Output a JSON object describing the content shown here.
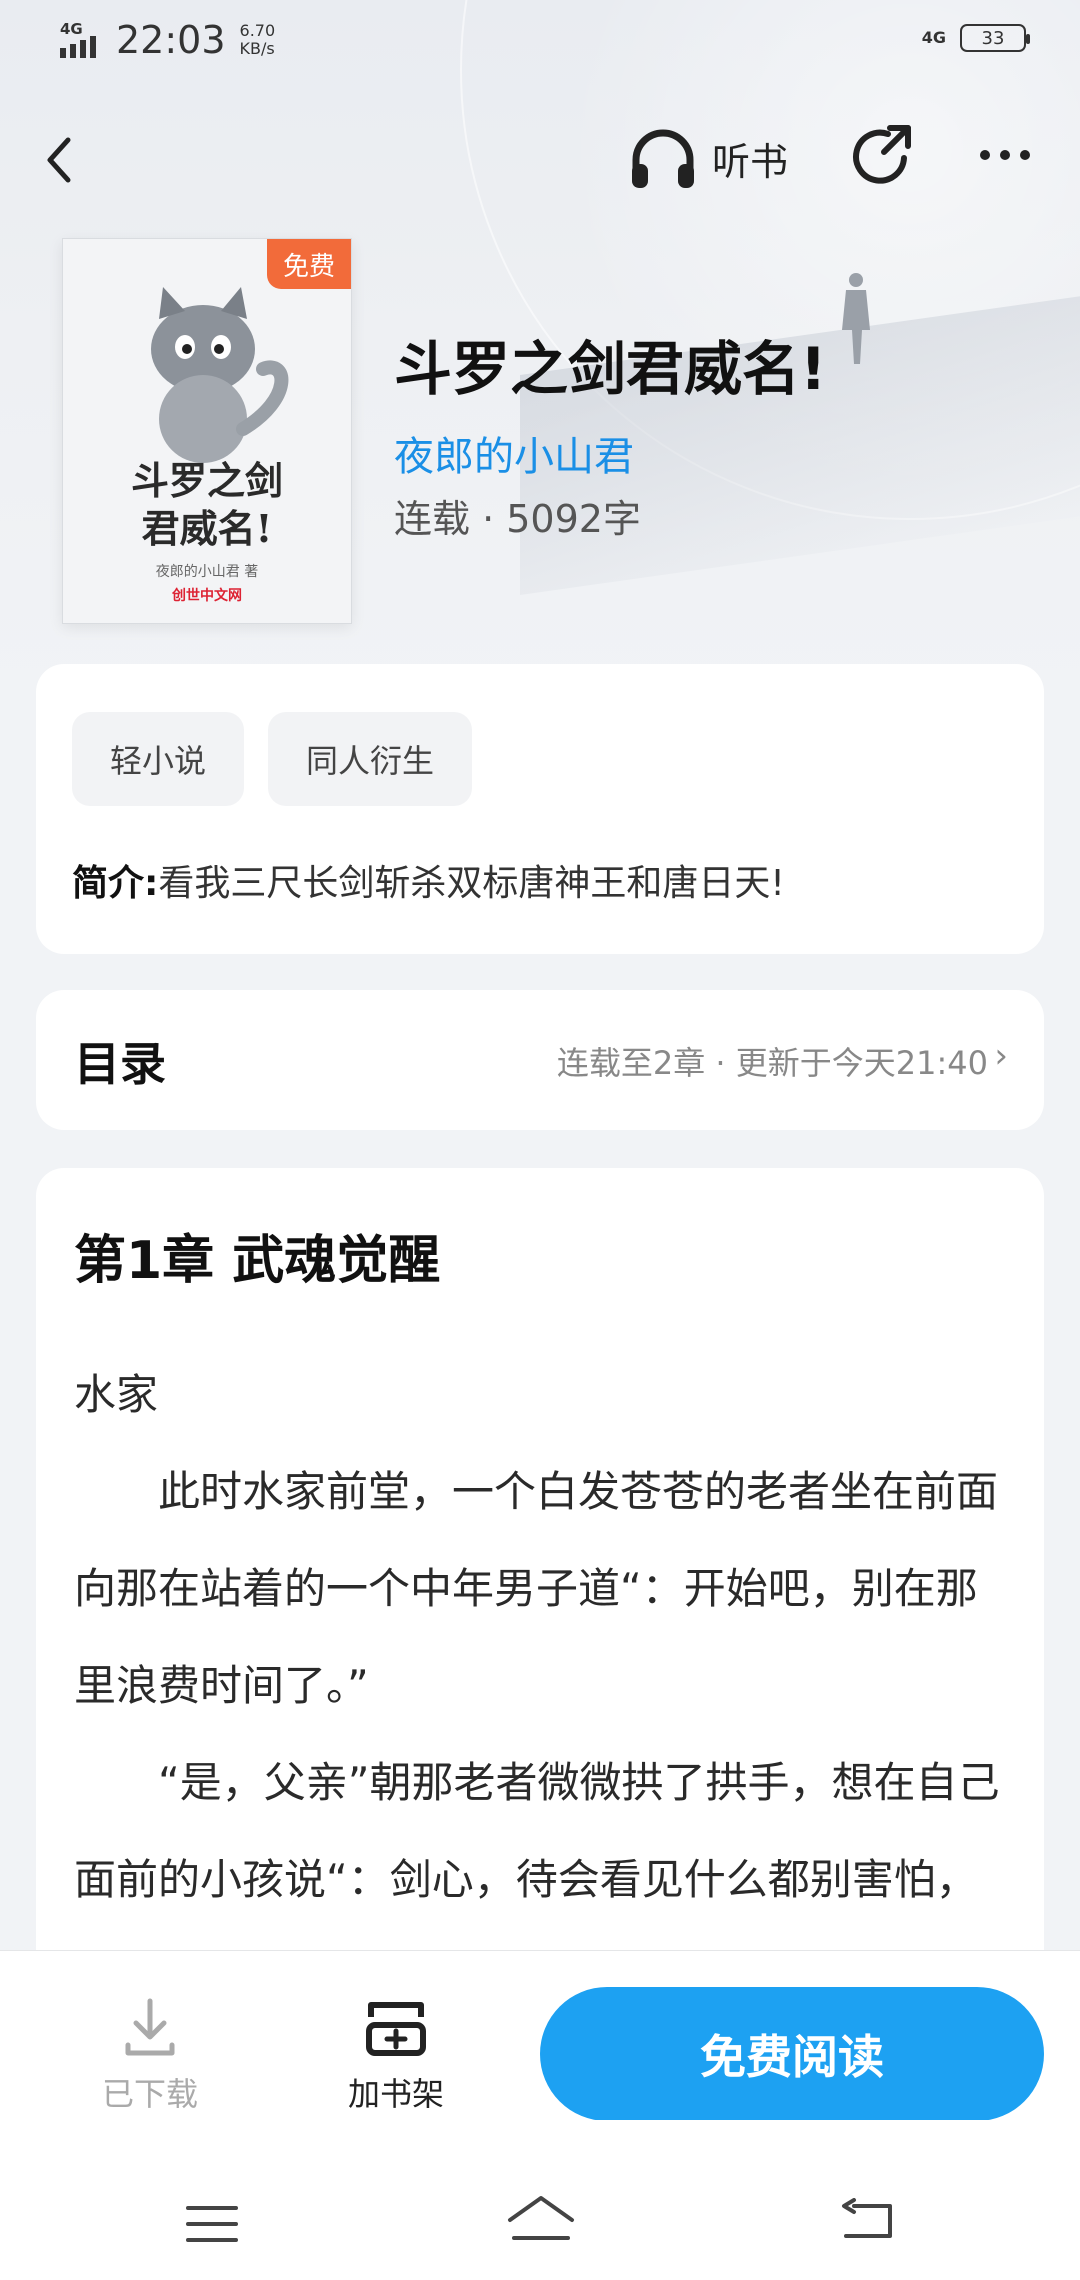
{
  "status_bar": {
    "network": "4G",
    "time": "22:03",
    "speed_value": "6.70",
    "speed_unit": "KB/s",
    "network_right": "4G",
    "battery": "33"
  },
  "nav": {
    "listen_label": "听书"
  },
  "book": {
    "cover_badge": "免费",
    "cover_title_line1": "斗罗之剑",
    "cover_title_line2": "君威名!",
    "cover_author": "夜郎的小山君 著",
    "cover_publisher": "创世中文网",
    "title": "斗罗之剑君威名!",
    "author": "夜郎的小山君",
    "meta": "连载 · 5092字"
  },
  "tags": [
    "轻小说",
    "同人衍生"
  ],
  "intro": {
    "label": "简介:",
    "text": "看我三尺长剑斩杀双标唐神王和唐日天!"
  },
  "toc": {
    "title": "目录",
    "info": "连载至2章 · 更新于今天21:40"
  },
  "chapter": {
    "title": "第1章 武魂觉醒",
    "paragraphs": [
      "水家",
      "此时水家前堂，一个白发苍苍的老者坐在前面向那在站着的一个中年男子道“：开始吧，别在那里浪费时间了。”",
      "“是，父亲”朝那老者微微拱了拱手，想在自己面前的小孩说“：剑心，待会看见什么都别害怕，这样才能觉醒武魂。”"
    ]
  },
  "actions": {
    "download_label": "已下载",
    "shelf_label": "加书架",
    "read_label": "免费阅读"
  }
}
